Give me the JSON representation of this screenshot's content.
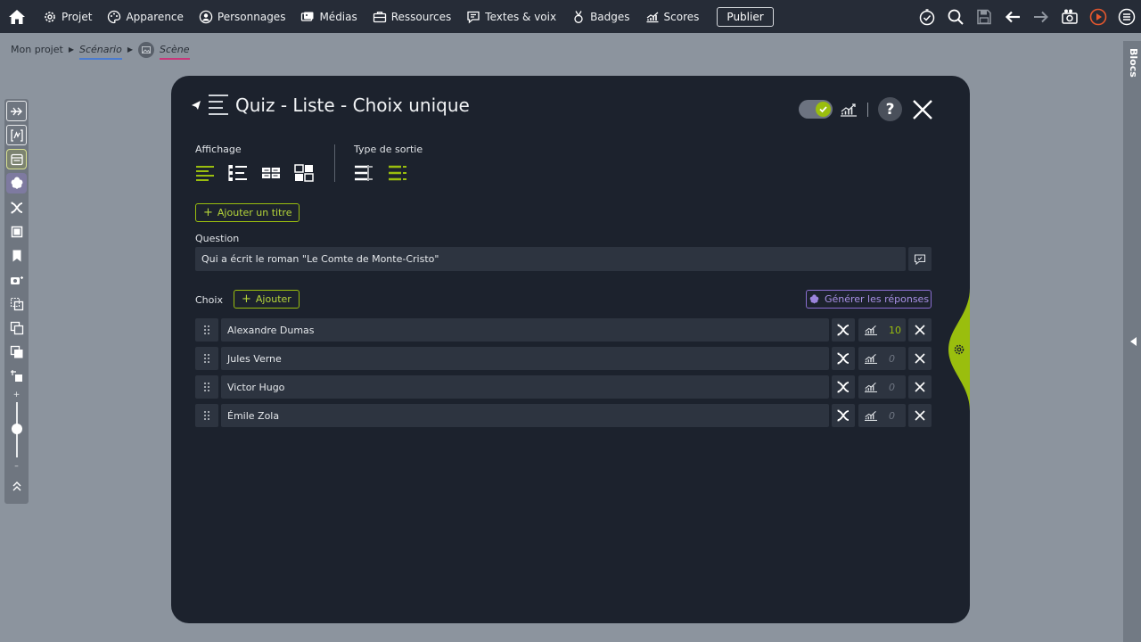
{
  "nav": {
    "items": [
      {
        "label": "Projet",
        "icon": "gear-icon"
      },
      {
        "label": "Apparence",
        "icon": "palette-icon"
      },
      {
        "label": "Personnages",
        "icon": "person-icon"
      },
      {
        "label": "Médias",
        "icon": "media-icon"
      },
      {
        "label": "Ressources",
        "icon": "briefcase-icon"
      },
      {
        "label": "Textes & voix",
        "icon": "chat-icon"
      },
      {
        "label": "Badges",
        "icon": "medal-icon"
      },
      {
        "label": "Scores",
        "icon": "chart-icon"
      }
    ],
    "publish_label": "Publier"
  },
  "breadcrumb": {
    "project": "Mon projet",
    "scenario": "Scénario",
    "scene": "Scène"
  },
  "right_rail": {
    "label": "Blocs"
  },
  "modal": {
    "title": "Quiz - Liste - Choix unique",
    "display_label": "Affichage",
    "output_label": "Type de sortie",
    "add_title_label": "Ajouter un titre",
    "question_label": "Question",
    "question_value": "Qui a écrit le roman \"Le Comte de Monte-Cristo\"",
    "choices_label": "Choix",
    "add_label": "Ajouter",
    "generate_label": "Générer les réponses",
    "choices": [
      {
        "text": "Alexandre Dumas",
        "score": "10"
      },
      {
        "text": "Jules Verne",
        "score": "0"
      },
      {
        "text": "Victor Hugo",
        "score": "0"
      },
      {
        "text": "Émile Zola",
        "score": "0"
      }
    ]
  },
  "colors": {
    "accent_green": "#9abe0e",
    "purple": "#8a6ed0",
    "modal_bg": "#1c222d",
    "topbar_bg": "#262c37"
  }
}
